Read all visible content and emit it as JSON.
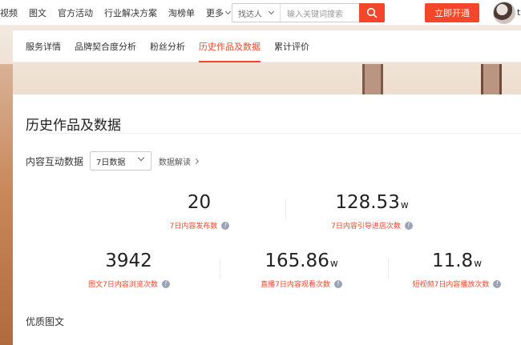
{
  "top_nav": {
    "items": [
      "视频",
      "图文",
      "官方活动",
      "行业解决方案",
      "淘榜单"
    ],
    "more_label": "更多",
    "search_type": "找达人",
    "search_placeholder": "输入关键词搜索",
    "cta_label": "立即开通",
    "user_name": "t"
  },
  "tabs": {
    "items": [
      "服务详情",
      "品牌契合度分析",
      "粉丝分析",
      "历史作品及数据",
      "累计评价"
    ],
    "active": "历史作品及数据"
  },
  "section": {
    "title": "历史作品及数据",
    "filter_label": "内容互动数据",
    "period_value": "7日数据",
    "explain_link": "数据解读"
  },
  "stats": [
    {
      "value": "20",
      "unit": "",
      "label": "7日内容发布数"
    },
    {
      "value": "128.53",
      "unit": "w",
      "label": "7日内容引导进店次数"
    },
    {
      "value": "3942",
      "unit": "",
      "label": "图文7日内容浏览次数"
    },
    {
      "value": "165.86",
      "unit": "w",
      "label": "直播7日内容观看次数"
    },
    {
      "value": "11.8",
      "unit": "w",
      "label": "短视频7日内容播放次数"
    }
  ],
  "subsection": {
    "title": "优质图文"
  },
  "colors": {
    "accent": "#f3462b",
    "info_icon": "#9aa3b5"
  }
}
